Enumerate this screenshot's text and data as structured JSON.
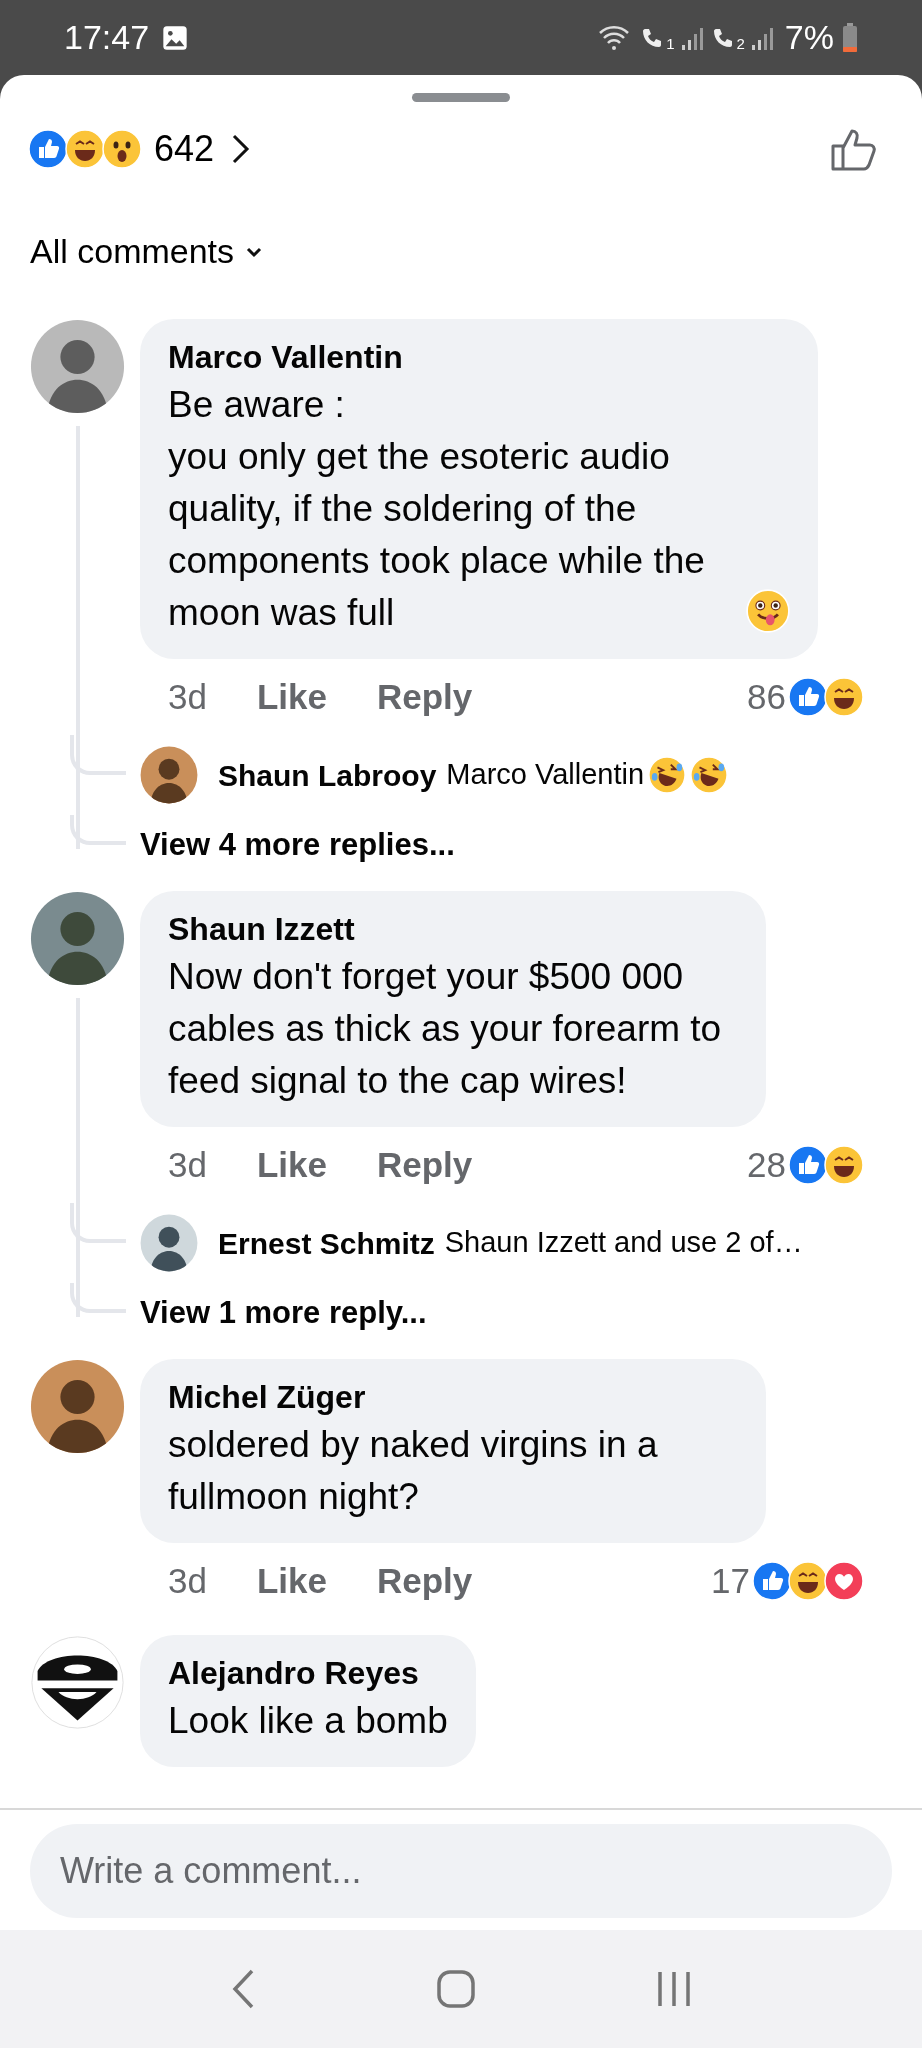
{
  "status_bar": {
    "time": "17:47",
    "sims": [
      {
        "label": "1"
      },
      {
        "label": "2"
      }
    ],
    "battery": "7%"
  },
  "reactions_summary": {
    "count": "642",
    "reactions": [
      {
        "kind": "like"
      },
      {
        "kind": "haha"
      },
      {
        "kind": "wow"
      }
    ]
  },
  "filter": {
    "label": "All comments"
  },
  "comments": [
    {
      "author": "Marco Vallentin",
      "avatar": {
        "kind": "photo"
      },
      "text": "Be aware :\nyou only get the esoteric audio quality, if the soldering of the components took place while the moon was full",
      "text_emoji": {
        "kind": "tongue"
      },
      "time": "3d",
      "like": "Like",
      "reply": "Reply",
      "reaction_count": "86",
      "reactions": [
        {
          "kind": "like"
        },
        {
          "kind": "haha"
        }
      ],
      "replies": [
        {
          "author": "Shaun Labrooy",
          "text": "Marco Vallentin",
          "emojis": [
            {
              "kind": "rofl"
            },
            {
              "kind": "rofl"
            }
          ]
        }
      ],
      "more_replies": "View 4 more replies..."
    },
    {
      "author": "Shaun Izzett",
      "avatar": {
        "kind": "photo"
      },
      "text": "Now don't forget your $500 000 cables as thick as your forearm to feed signal to the cap wires!",
      "time": "3d",
      "like": "Like",
      "reply": "Reply",
      "reaction_count": "28",
      "reactions": [
        {
          "kind": "like"
        },
        {
          "kind": "haha"
        }
      ],
      "replies": [
        {
          "author": "Ernest Schmitz",
          "text": "Shaun Izzett and use 2 of…"
        }
      ],
      "more_replies": "View 1 more reply..."
    },
    {
      "author": "Michel Züger",
      "avatar": {
        "kind": "photo"
      },
      "text": "soldered by naked virgins in a fullmoon night?",
      "time": "3d",
      "like": "Like",
      "reply": "Reply",
      "reaction_count": "17",
      "reactions": [
        {
          "kind": "like"
        },
        {
          "kind": "haha"
        },
        {
          "kind": "love"
        }
      ]
    },
    {
      "author": "Alejandro Reyes",
      "avatar": {
        "kind": "logo"
      },
      "text": "Look like a bomb"
    }
  ],
  "composer": {
    "placeholder": "Write a comment..."
  }
}
